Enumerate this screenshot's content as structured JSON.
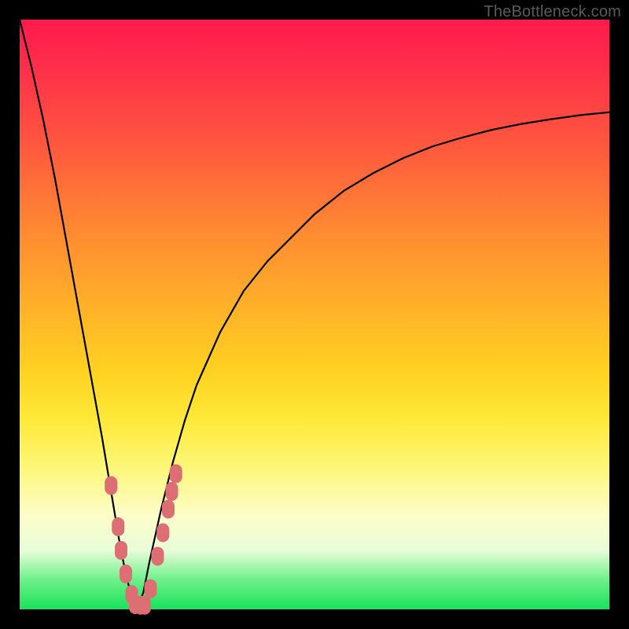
{
  "watermark": "TheBottleneck.com",
  "chart_data": {
    "type": "line",
    "title": "",
    "xlabel": "",
    "ylabel": "",
    "xlim": [
      0,
      1
    ],
    "ylim": [
      0,
      100
    ],
    "annotations": [],
    "background_gradient": {
      "top": "#ff1a4d",
      "mid": "#ffd321",
      "bottom": "#18e25a"
    },
    "series": [
      {
        "name": "left-branch",
        "color": "#000000",
        "x": [
          0.0,
          0.02,
          0.04,
          0.06,
          0.08,
          0.1,
          0.12,
          0.14,
          0.16,
          0.17,
          0.18,
          0.19,
          0.2
        ],
        "y": [
          100,
          92,
          83,
          73,
          62,
          51,
          40,
          29,
          17,
          11,
          6,
          2,
          0
        ]
      },
      {
        "name": "right-branch",
        "color": "#000000",
        "x": [
          0.2,
          0.21,
          0.22,
          0.24,
          0.26,
          0.28,
          0.3,
          0.34,
          0.38,
          0.42,
          0.46,
          0.5,
          0.55,
          0.6,
          0.65,
          0.7,
          0.75,
          0.8,
          0.85,
          0.9,
          0.95,
          1.0
        ],
        "y": [
          0,
          3,
          8,
          17,
          25,
          32,
          38,
          47,
          54,
          59,
          63,
          67,
          71,
          74,
          76.5,
          78.5,
          80,
          81.3,
          82.3,
          83.1,
          83.8,
          84.3
        ]
      }
    ],
    "markers": {
      "name": "highlighted-points",
      "color": "#db6f73",
      "shape": "rounded-capsule",
      "points": [
        {
          "x": 0.155,
          "y": 21
        },
        {
          "x": 0.167,
          "y": 14
        },
        {
          "x": 0.172,
          "y": 10
        },
        {
          "x": 0.18,
          "y": 6
        },
        {
          "x": 0.19,
          "y": 2.5
        },
        {
          "x": 0.196,
          "y": 0.8
        },
        {
          "x": 0.205,
          "y": 0.7
        },
        {
          "x": 0.212,
          "y": 0.7
        },
        {
          "x": 0.222,
          "y": 3.5
        },
        {
          "x": 0.234,
          "y": 9
        },
        {
          "x": 0.243,
          "y": 13
        },
        {
          "x": 0.252,
          "y": 17
        },
        {
          "x": 0.258,
          "y": 20
        },
        {
          "x": 0.265,
          "y": 23
        }
      ]
    }
  }
}
